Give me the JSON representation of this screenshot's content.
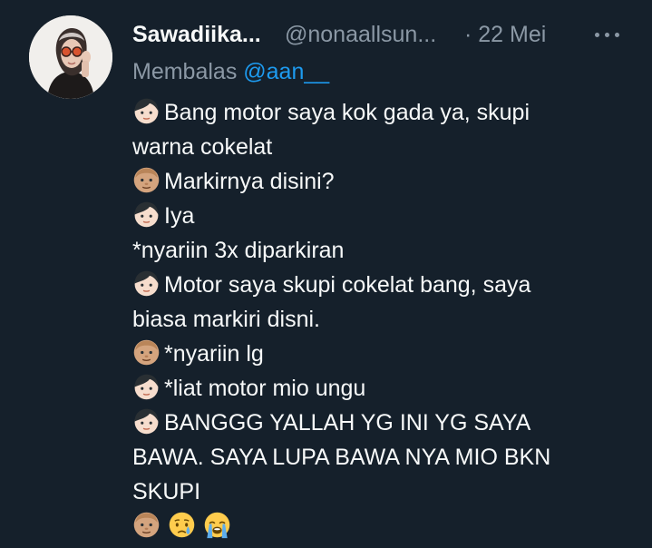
{
  "tweet": {
    "display_name": "Sawadiika...",
    "handle": "@nonaallsun...",
    "date": "· 22 Mei",
    "reply_prefix": "Membalas ",
    "reply_handle": "@aan__",
    "icons": {
      "more": "more-icon",
      "girl_face": "girl-face-emoji",
      "man_face": "man-face-emoji",
      "crying_face": "crying-face-emoji",
      "loudly_crying_face": "loudly-crying-face-emoji"
    },
    "lines": [
      {
        "emoji": "girl",
        "text": "Bang motor saya kok gada ya, skupi"
      },
      {
        "emoji": "",
        "text": "warna cokelat"
      },
      {
        "emoji": "man",
        "text": "Markirnya disini?"
      },
      {
        "emoji": "girl",
        "text": "Iya"
      },
      {
        "emoji": "",
        "text": "*nyariin 3x diparkiran"
      },
      {
        "emoji": "girl",
        "text": "Motor saya skupi cokelat bang, saya"
      },
      {
        "emoji": "",
        "text": "biasa markiri disni."
      },
      {
        "emoji": "man",
        "text": "*nyariin lg"
      },
      {
        "emoji": "girl",
        "text": "*liat motor mio ungu"
      },
      {
        "emoji": "girl",
        "text": "BANGGG YALLAH YG INI YG SAYA"
      },
      {
        "emoji": "",
        "text": "BAWA. SAYA LUPA BAWA NYA MIO BKN"
      },
      {
        "emoji": "",
        "text": "SKUPI"
      }
    ],
    "final_emojis": [
      "man",
      "crying",
      "loudly-crying"
    ]
  },
  "colors": {
    "background": "#15202b",
    "primary_text": "#f7f9f9",
    "secondary_text": "#8b98a5",
    "link": "#1d9bf0"
  }
}
